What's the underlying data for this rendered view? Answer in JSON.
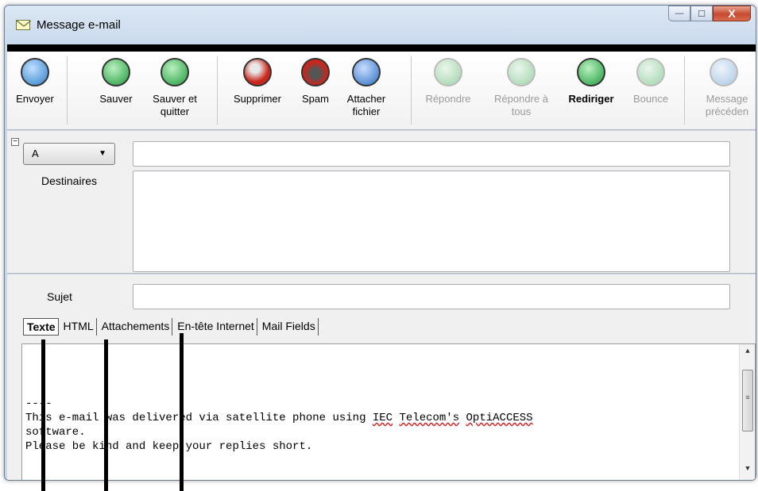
{
  "window": {
    "title": "Message e-mail"
  },
  "caption": {
    "minimize": "—",
    "maximize": "☐",
    "close": "X"
  },
  "toolbar": {
    "buttons": [
      {
        "id": "envoyer",
        "label": "Envoyer",
        "icon": "send-icon",
        "color": "#2e7ec9",
        "enabled": true
      },
      {
        "id": "sauver",
        "label": "Sauver",
        "icon": "save-icon",
        "color": "#1e9a3a",
        "enabled": true
      },
      {
        "id": "sauver-quitter",
        "label": "Sauver et quitter",
        "icon": "save-close-icon",
        "color": "#1e9a3a",
        "enabled": true
      },
      {
        "id": "supprimer",
        "label": "Supprimer",
        "icon": "trash-icon",
        "color": "#c9261d",
        "enabled": true
      },
      {
        "id": "spam",
        "label": "Spam",
        "icon": "spam-icon",
        "color": "#c9261d",
        "enabled": true
      },
      {
        "id": "attacher",
        "label": "Attacher fichier",
        "icon": "paperclip-icon",
        "color": "#2a6fc1",
        "enabled": true
      },
      {
        "id": "repondre",
        "label": "Répondre",
        "icon": "reply-icon",
        "color": "#9ed1a8",
        "enabled": false
      },
      {
        "id": "repondre-tous",
        "label": "Répondre à tous",
        "icon": "reply-all-icon",
        "color": "#9ed1a8",
        "enabled": false
      },
      {
        "id": "rediriger",
        "label": "Rediriger",
        "icon": "redirect-icon",
        "color": "#1e9a3a",
        "enabled": true
      },
      {
        "id": "bounce",
        "label": "Bounce",
        "icon": "bounce-icon",
        "color": "#9ed1a8",
        "enabled": false
      },
      {
        "id": "message-precedent",
        "label": "Message précéden",
        "icon": "previous-message-icon",
        "color": "#a9c7e4",
        "enabled": false
      }
    ]
  },
  "form": {
    "recipient_type": "A",
    "to_value": "",
    "destinaires_label": "Destinaires",
    "subject_label": "Sujet",
    "subject_value": "",
    "collapse_glyph": "−"
  },
  "tabs": [
    {
      "label": "Texte",
      "active": true
    },
    {
      "label": "HTML",
      "active": false
    },
    {
      "label": "Attachements",
      "active": false
    },
    {
      "label": "En-tête Internet",
      "active": false
    },
    {
      "label": "Mail Fields",
      "active": false
    }
  ],
  "body": {
    "line1": "----",
    "line2a": "This e-mail was delivered via satellite phone using ",
    "line2b": "IEC",
    "line2c": " ",
    "line2d": "Telecom's",
    "line2e": " ",
    "line2f": "OptiACCESS",
    "line3": "software.",
    "line4": "Please be kind and keep your replies short."
  }
}
